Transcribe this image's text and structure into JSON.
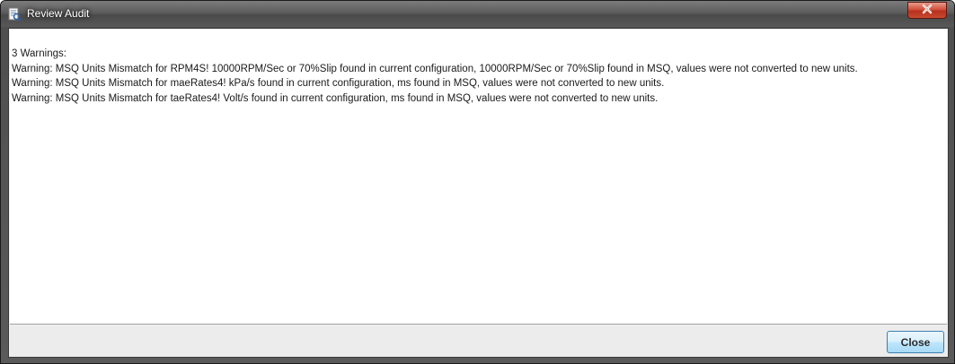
{
  "window": {
    "title": "Review Audit",
    "icon": "audit-document-icon",
    "close_icon": "close-icon"
  },
  "audit": {
    "summary": "3 Warnings:",
    "warnings": [
      "Warning: MSQ Units Mismatch for RPM4S! 10000RPM/Sec or 70%Slip found in current configuration, 10000RPM/Sec or 70%Slip  found in MSQ, values were not converted to new units.",
      "Warning: MSQ Units Mismatch for maeRates4! kPa/s found in current configuration, ms found in MSQ, values were not converted to new units.",
      "Warning: MSQ Units Mismatch for taeRates4! Volt/s found in current configuration, ms found in MSQ, values were not converted to new units."
    ]
  },
  "footer": {
    "close_label": "Close"
  },
  "colors": {
    "close_x_red": "#c94a30",
    "button_border": "#3c7fb1"
  }
}
